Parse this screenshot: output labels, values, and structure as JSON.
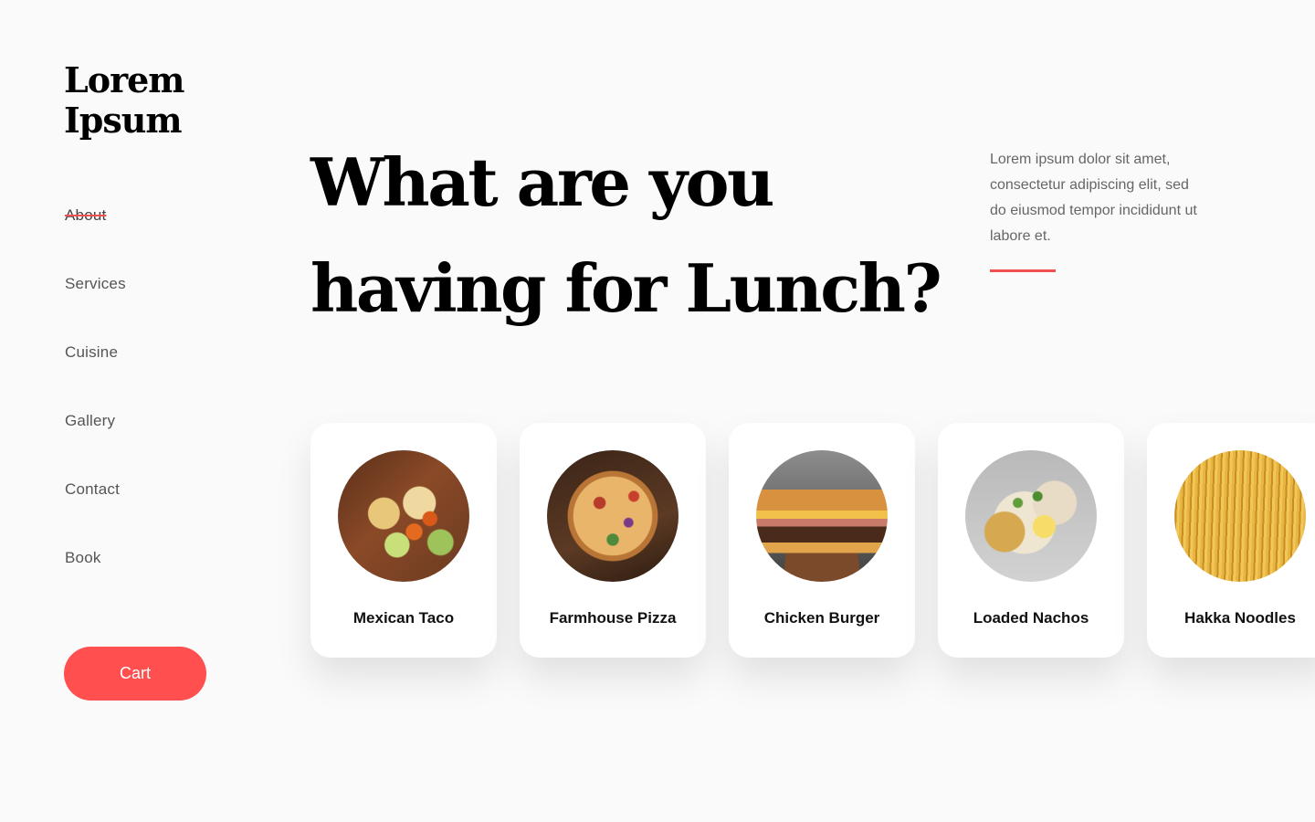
{
  "brand": {
    "line1": "Lorem",
    "line2": "Ipsum"
  },
  "nav": {
    "items": [
      {
        "label": "About",
        "active": true
      },
      {
        "label": "Services"
      },
      {
        "label": "Cuisine"
      },
      {
        "label": "Gallery"
      },
      {
        "label": "Contact"
      },
      {
        "label": "Book"
      }
    ]
  },
  "cart": {
    "label": "Cart"
  },
  "hero": {
    "title_line1": "What are you",
    "title_line2": "having for Lunch?",
    "description": "Lorem ipsum dolor sit amet, consectetur adipiscing elit, sed do eiusmod tempor incididunt ut labore et."
  },
  "dishes": [
    {
      "name": "Mexican Taco",
      "image": "taco-photo"
    },
    {
      "name": "Farmhouse Pizza",
      "image": "pizza-photo"
    },
    {
      "name": "Chicken Burger",
      "image": "burger-photo"
    },
    {
      "name": "Loaded Nachos",
      "image": "nachos-photo"
    },
    {
      "name": "Hakka Noodles",
      "image": "noodles-photo"
    }
  ],
  "colors": {
    "accent": "#ff4f4f",
    "background": "#fafafa",
    "card": "#ffffff",
    "text_muted": "#666666"
  }
}
